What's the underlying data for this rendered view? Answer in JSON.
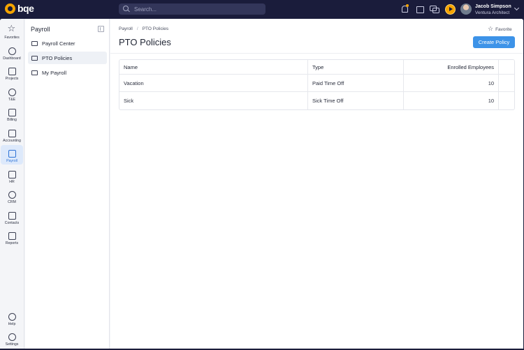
{
  "brand": {
    "name": "bqe",
    "accent": "#f5a400"
  },
  "topbar": {
    "search_placeholder": "Search...",
    "icons": [
      "bell-icon",
      "calendar-icon",
      "chat-icon",
      "timer-play-icon"
    ],
    "user": {
      "name": "Jacob Simpson",
      "role": "Ventura Architect"
    }
  },
  "rail": {
    "items": [
      {
        "label": "Favorites",
        "icon": "star-icon"
      },
      {
        "label": "Dashboard",
        "icon": "gauge-icon"
      },
      {
        "label": "Projects",
        "icon": "briefcase-icon"
      },
      {
        "label": "T&E",
        "icon": "clock-icon"
      },
      {
        "label": "Billing",
        "icon": "invoice-icon"
      },
      {
        "label": "Accounting",
        "icon": "calculator-icon"
      },
      {
        "label": "Payroll",
        "icon": "payroll-icon"
      },
      {
        "label": "HR",
        "icon": "person-badge-icon"
      },
      {
        "label": "CRM",
        "icon": "network-icon"
      },
      {
        "label": "Contacts",
        "icon": "contact-card-icon"
      },
      {
        "label": "Reports",
        "icon": "chart-icon"
      }
    ],
    "footer": [
      {
        "label": "Help",
        "icon": "help-icon"
      },
      {
        "label": "Settings",
        "icon": "gear-icon"
      }
    ],
    "active": "Payroll"
  },
  "subnav": {
    "title": "Payroll",
    "items": [
      {
        "label": "Payroll Center",
        "icon": "payroll-center-icon"
      },
      {
        "label": "PTO Policies",
        "icon": "beach-icon"
      },
      {
        "label": "My Payroll",
        "icon": "money-icon"
      }
    ],
    "active": "PTO Policies"
  },
  "main": {
    "breadcrumb": [
      "Payroll",
      "PTO Policies"
    ],
    "favorite_label": "Favorite",
    "title": "PTO Policies",
    "create_button": "Create Policy",
    "table": {
      "columns": [
        "Name",
        "Type",
        "Enrolled Employees"
      ],
      "rows": [
        {
          "name": "Vacation",
          "type": "Paid Time Off",
          "enrolled": "10"
        },
        {
          "name": "Sick",
          "type": "Sick Time Off",
          "enrolled": "10"
        }
      ]
    }
  }
}
